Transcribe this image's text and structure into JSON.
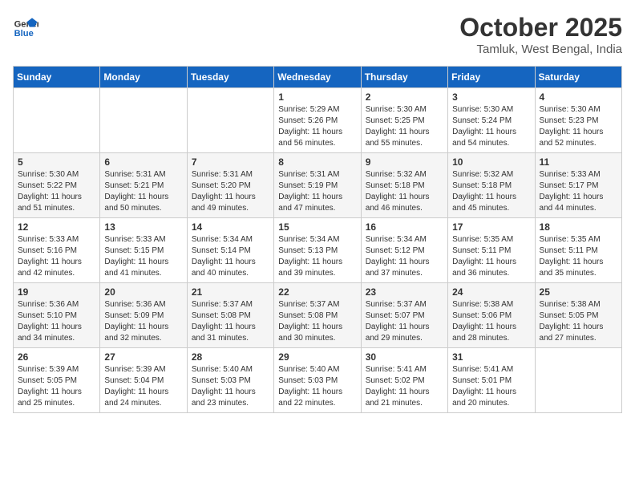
{
  "header": {
    "logo_line1": "General",
    "logo_line2": "Blue",
    "month": "October 2025",
    "location": "Tamluk, West Bengal, India"
  },
  "weekdays": [
    "Sunday",
    "Monday",
    "Tuesday",
    "Wednesday",
    "Thursday",
    "Friday",
    "Saturday"
  ],
  "weeks": [
    [
      {
        "day": "",
        "info": ""
      },
      {
        "day": "",
        "info": ""
      },
      {
        "day": "",
        "info": ""
      },
      {
        "day": "1",
        "info": "Sunrise: 5:29 AM\nSunset: 5:26 PM\nDaylight: 11 hours\nand 56 minutes."
      },
      {
        "day": "2",
        "info": "Sunrise: 5:30 AM\nSunset: 5:25 PM\nDaylight: 11 hours\nand 55 minutes."
      },
      {
        "day": "3",
        "info": "Sunrise: 5:30 AM\nSunset: 5:24 PM\nDaylight: 11 hours\nand 54 minutes."
      },
      {
        "day": "4",
        "info": "Sunrise: 5:30 AM\nSunset: 5:23 PM\nDaylight: 11 hours\nand 52 minutes."
      }
    ],
    [
      {
        "day": "5",
        "info": "Sunrise: 5:30 AM\nSunset: 5:22 PM\nDaylight: 11 hours\nand 51 minutes."
      },
      {
        "day": "6",
        "info": "Sunrise: 5:31 AM\nSunset: 5:21 PM\nDaylight: 11 hours\nand 50 minutes."
      },
      {
        "day": "7",
        "info": "Sunrise: 5:31 AM\nSunset: 5:20 PM\nDaylight: 11 hours\nand 49 minutes."
      },
      {
        "day": "8",
        "info": "Sunrise: 5:31 AM\nSunset: 5:19 PM\nDaylight: 11 hours\nand 47 minutes."
      },
      {
        "day": "9",
        "info": "Sunrise: 5:32 AM\nSunset: 5:18 PM\nDaylight: 11 hours\nand 46 minutes."
      },
      {
        "day": "10",
        "info": "Sunrise: 5:32 AM\nSunset: 5:18 PM\nDaylight: 11 hours\nand 45 minutes."
      },
      {
        "day": "11",
        "info": "Sunrise: 5:33 AM\nSunset: 5:17 PM\nDaylight: 11 hours\nand 44 minutes."
      }
    ],
    [
      {
        "day": "12",
        "info": "Sunrise: 5:33 AM\nSunset: 5:16 PM\nDaylight: 11 hours\nand 42 minutes."
      },
      {
        "day": "13",
        "info": "Sunrise: 5:33 AM\nSunset: 5:15 PM\nDaylight: 11 hours\nand 41 minutes."
      },
      {
        "day": "14",
        "info": "Sunrise: 5:34 AM\nSunset: 5:14 PM\nDaylight: 11 hours\nand 40 minutes."
      },
      {
        "day": "15",
        "info": "Sunrise: 5:34 AM\nSunset: 5:13 PM\nDaylight: 11 hours\nand 39 minutes."
      },
      {
        "day": "16",
        "info": "Sunrise: 5:34 AM\nSunset: 5:12 PM\nDaylight: 11 hours\nand 37 minutes."
      },
      {
        "day": "17",
        "info": "Sunrise: 5:35 AM\nSunset: 5:11 PM\nDaylight: 11 hours\nand 36 minutes."
      },
      {
        "day": "18",
        "info": "Sunrise: 5:35 AM\nSunset: 5:11 PM\nDaylight: 11 hours\nand 35 minutes."
      }
    ],
    [
      {
        "day": "19",
        "info": "Sunrise: 5:36 AM\nSunset: 5:10 PM\nDaylight: 11 hours\nand 34 minutes."
      },
      {
        "day": "20",
        "info": "Sunrise: 5:36 AM\nSunset: 5:09 PM\nDaylight: 11 hours\nand 32 minutes."
      },
      {
        "day": "21",
        "info": "Sunrise: 5:37 AM\nSunset: 5:08 PM\nDaylight: 11 hours\nand 31 minutes."
      },
      {
        "day": "22",
        "info": "Sunrise: 5:37 AM\nSunset: 5:08 PM\nDaylight: 11 hours\nand 30 minutes."
      },
      {
        "day": "23",
        "info": "Sunrise: 5:37 AM\nSunset: 5:07 PM\nDaylight: 11 hours\nand 29 minutes."
      },
      {
        "day": "24",
        "info": "Sunrise: 5:38 AM\nSunset: 5:06 PM\nDaylight: 11 hours\nand 28 minutes."
      },
      {
        "day": "25",
        "info": "Sunrise: 5:38 AM\nSunset: 5:05 PM\nDaylight: 11 hours\nand 27 minutes."
      }
    ],
    [
      {
        "day": "26",
        "info": "Sunrise: 5:39 AM\nSunset: 5:05 PM\nDaylight: 11 hours\nand 25 minutes."
      },
      {
        "day": "27",
        "info": "Sunrise: 5:39 AM\nSunset: 5:04 PM\nDaylight: 11 hours\nand 24 minutes."
      },
      {
        "day": "28",
        "info": "Sunrise: 5:40 AM\nSunset: 5:03 PM\nDaylight: 11 hours\nand 23 minutes."
      },
      {
        "day": "29",
        "info": "Sunrise: 5:40 AM\nSunset: 5:03 PM\nDaylight: 11 hours\nand 22 minutes."
      },
      {
        "day": "30",
        "info": "Sunrise: 5:41 AM\nSunset: 5:02 PM\nDaylight: 11 hours\nand 21 minutes."
      },
      {
        "day": "31",
        "info": "Sunrise: 5:41 AM\nSunset: 5:01 PM\nDaylight: 11 hours\nand 20 minutes."
      },
      {
        "day": "",
        "info": ""
      }
    ]
  ]
}
